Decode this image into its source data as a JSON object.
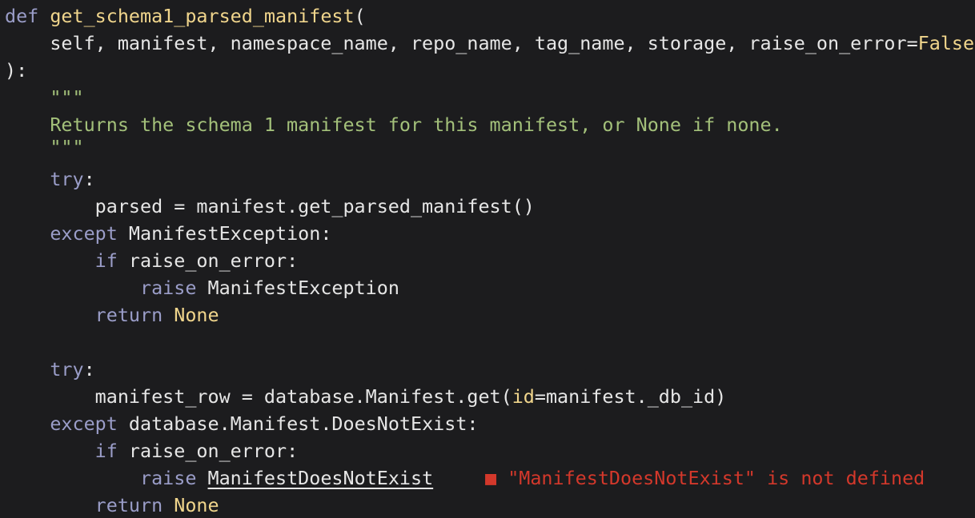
{
  "code": {
    "l1": {
      "kw": "def",
      "fn": "get_schema1_parsed_manifest",
      "rest": "("
    },
    "l2": {
      "text": "    self, manifest, namespace_name, repo_name, tag_name, storage, raise_on_error=",
      "val": "False"
    },
    "l3": {
      "text": "):"
    },
    "l4": {
      "text": "    \"\"\""
    },
    "l5": {
      "text": "    Returns the schema 1 manifest for this manifest, or None if none."
    },
    "l6": {
      "text": "    \"\"\""
    },
    "l7": {
      "indent": "    ",
      "kw": "try",
      "rest": ":"
    },
    "l8": {
      "text": "        parsed = manifest.get_parsed_manifest()"
    },
    "l9": {
      "indent": "    ",
      "kw": "except",
      "rest": " ManifestException:"
    },
    "l10": {
      "indent": "        ",
      "kw": "if",
      "rest": " raise_on_error:"
    },
    "l11": {
      "indent": "            ",
      "kw": "raise",
      "rest": " ManifestException"
    },
    "l12": {
      "indent": "        ",
      "kw": "return",
      "sp": " ",
      "val": "None"
    },
    "l14": {
      "indent": "    ",
      "kw": "try",
      "rest": ":"
    },
    "l15": {
      "pre": "        manifest_row = database.Manifest.get(",
      "param": "id",
      "post": "=manifest._db_id)"
    },
    "l16": {
      "indent": "    ",
      "kw": "except",
      "rest": " database.Manifest.DoesNotExist:"
    },
    "l17": {
      "indent": "        ",
      "kw": "if",
      "rest": " raise_on_error:"
    },
    "l18": {
      "indent": "            ",
      "kw": "raise",
      "sp": " ",
      "undef": "ManifestDoesNotExist"
    },
    "l19": {
      "indent": "        ",
      "kw": "return",
      "sp": " ",
      "val": "None"
    }
  },
  "diagnostic": {
    "icon": "■",
    "message": "\"ManifestDoesNotExist\" is not defined",
    "color": "#d3382b"
  }
}
